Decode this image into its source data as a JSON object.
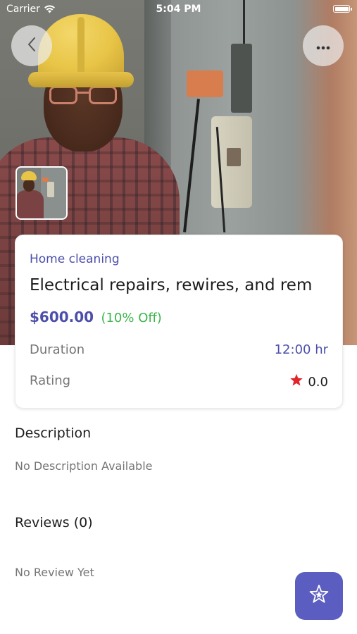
{
  "status_bar": {
    "carrier": "Carrier",
    "time": "5:04 PM"
  },
  "header": {
    "back_icon": "chevron-left-icon",
    "more_icon": "more-horizontal-icon"
  },
  "service": {
    "category": "Home cleaning",
    "title": "Electrical repairs, rewires, and rem",
    "price": "$600.00",
    "discount": "(10% Off)",
    "duration_label": "Duration",
    "duration_value": "12:00 hr",
    "rating_label": "Rating",
    "rating_value": "0.0"
  },
  "description": {
    "title": "Description",
    "text": "No Description Available"
  },
  "reviews": {
    "title": "Reviews (0)",
    "text": "No Review Yet"
  },
  "fab": {
    "icon": "star-badge-icon"
  },
  "colors": {
    "accent": "#5b5ec0",
    "price": "#4c4faa",
    "discount": "#3bb54a",
    "rating_star": "#e0262b",
    "muted": "#757575"
  }
}
